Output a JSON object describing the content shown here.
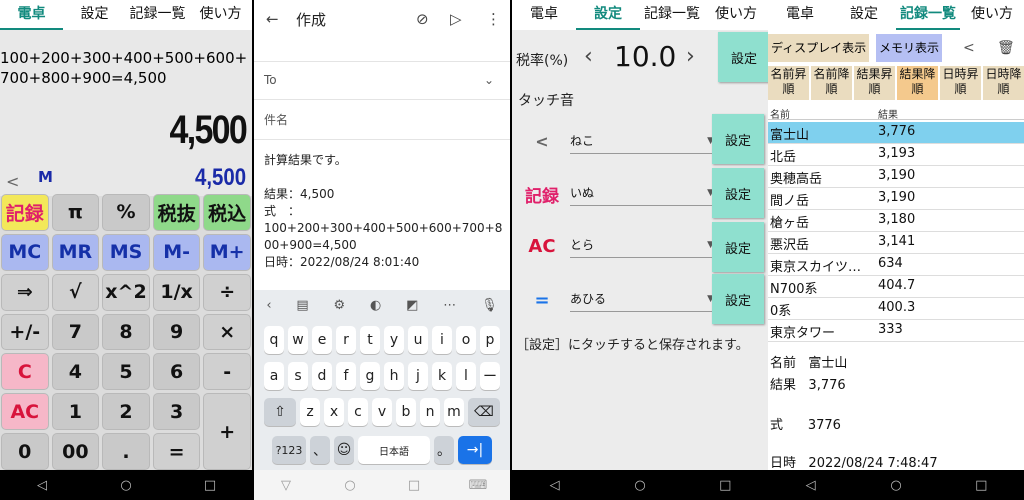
{
  "tabs": [
    "電卓",
    "設定",
    "記録一覧",
    "使い方"
  ],
  "nav": {
    "back": "◁",
    "home": "○",
    "recent": "□"
  },
  "calc": {
    "expression": "100+200+300+400+500+600+700+800+900=4,500",
    "result": "4,500",
    "memory_value": "4,500",
    "memory_indicator": "M",
    "keys": [
      {
        "label": "記録",
        "style": "yellow"
      },
      {
        "label": "π",
        "style": ""
      },
      {
        "label": "%",
        "style": ""
      },
      {
        "label": "税抜",
        "style": "green"
      },
      {
        "label": "税込",
        "style": "green"
      },
      {
        "label": "MC",
        "style": "blue"
      },
      {
        "label": "MR",
        "style": "blue"
      },
      {
        "label": "MS",
        "style": "blue"
      },
      {
        "label": "M-",
        "style": "blue"
      },
      {
        "label": "M+",
        "style": "blue"
      },
      {
        "label": "⇒",
        "style": "op"
      },
      {
        "label": "√",
        "style": "op"
      },
      {
        "label": "x^2",
        "style": "op"
      },
      {
        "label": "1/x",
        "style": "op"
      },
      {
        "label": "÷",
        "style": "op"
      },
      {
        "label": "+/-",
        "style": "op"
      },
      {
        "label": "7",
        "style": ""
      },
      {
        "label": "8",
        "style": ""
      },
      {
        "label": "9",
        "style": ""
      },
      {
        "label": "×",
        "style": "op"
      },
      {
        "label": "C",
        "style": "pink"
      },
      {
        "label": "4",
        "style": ""
      },
      {
        "label": "5",
        "style": ""
      },
      {
        "label": "6",
        "style": ""
      },
      {
        "label": "-",
        "style": "op"
      },
      {
        "label": "AC",
        "style": "pink"
      },
      {
        "label": "1",
        "style": ""
      },
      {
        "label": "2",
        "style": ""
      },
      {
        "label": "3",
        "style": ""
      },
      {
        "label": "+",
        "style": "op tall"
      },
      {
        "label": "0",
        "style": ""
      },
      {
        "label": "00",
        "style": ""
      },
      {
        "label": ".",
        "style": ""
      },
      {
        "label": "=",
        "style": "op"
      }
    ]
  },
  "email": {
    "title": "作成",
    "to_label": "To",
    "subject_placeholder": "件名",
    "body": [
      "計算結果です。",
      "",
      "結果：4,500",
      "式　：",
      "100+200+300+400+500+600+700+800+900=4,500",
      "日時：2022/08/24 8:01:40"
    ],
    "keyboard": {
      "row1": [
        "q",
        "w",
        "e",
        "r",
        "t",
        "y",
        "u",
        "i",
        "o",
        "p"
      ],
      "row2": [
        "a",
        "s",
        "d",
        "f",
        "g",
        "h",
        "j",
        "k",
        "l",
        "ー"
      ],
      "row3": [
        "z",
        "x",
        "c",
        "v",
        "b",
        "n",
        "m"
      ],
      "numkey": "?123",
      "comma": "、",
      "lang": "日本語",
      "period": "。"
    }
  },
  "settings": {
    "tax_label": "税率(%)",
    "tax_value": "10.0",
    "touch_label": "タッチ音",
    "set_label": "設定",
    "sounds": [
      {
        "icon": "share",
        "value": "ねこ"
      },
      {
        "icon": "記録",
        "value": "いぬ"
      },
      {
        "icon": "AC",
        "value": "とら"
      },
      {
        "icon": "=",
        "value": "あひる"
      }
    ],
    "note": "［設定］にタッチすると保存されます。"
  },
  "history": {
    "display_btn": "ディスプレイ表示",
    "memory_btn": "メモリ表示",
    "sorts": [
      "名前昇順",
      "名前降順",
      "結果昇順",
      "結果降順",
      "日時昇順",
      "日時降順"
    ],
    "col_name": "名前",
    "col_result": "結果",
    "rows": [
      {
        "name": "富士山",
        "result": "3,776"
      },
      {
        "name": "北岳",
        "result": "3,193"
      },
      {
        "name": "奥穂高岳",
        "result": "3,190"
      },
      {
        "name": "間ノ岳",
        "result": "3,190"
      },
      {
        "name": "槍ヶ岳",
        "result": "3,180"
      },
      {
        "name": "悪沢岳",
        "result": "3,141"
      },
      {
        "name": "東京スカイツ…",
        "result": "634"
      },
      {
        "name": "N700系",
        "result": "404.7"
      },
      {
        "name": "0系",
        "result": "400.3"
      },
      {
        "name": "東京タワー",
        "result": "333"
      }
    ],
    "detail": {
      "name_label": "名前",
      "name": "富士山",
      "result_label": "結果",
      "result": "3,776",
      "formula_label": "式",
      "formula": "3776",
      "date_label": "日時",
      "date": "2022/08/24 7:48:47"
    }
  }
}
